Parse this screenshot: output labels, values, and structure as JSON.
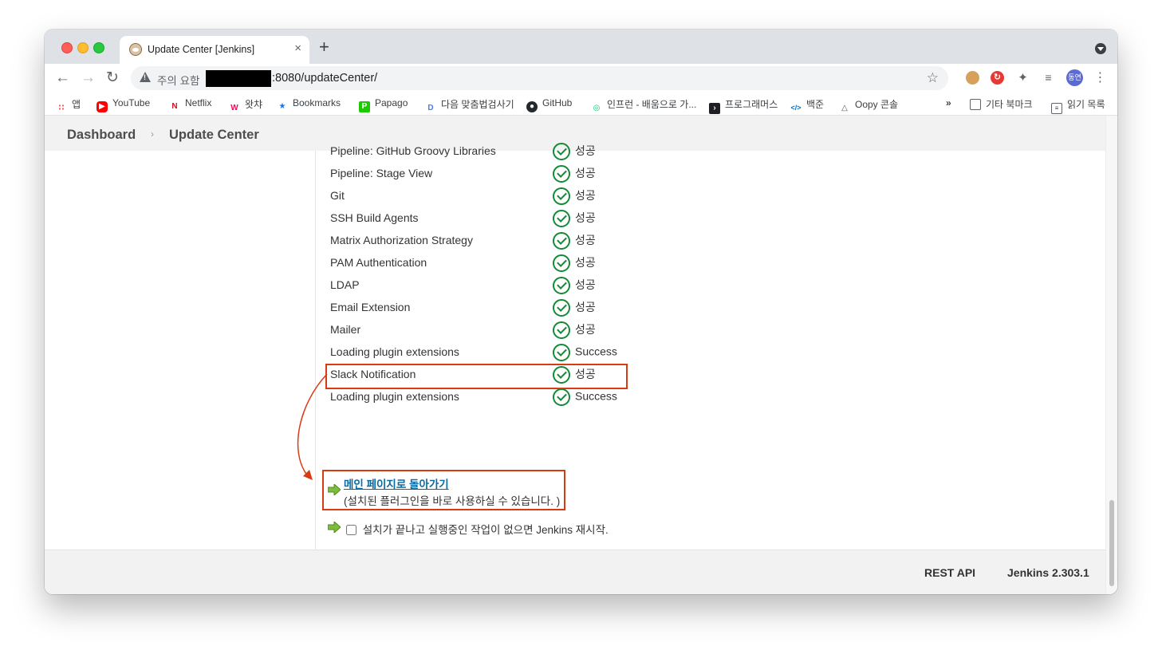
{
  "browser": {
    "tab_title": "Update Center [Jenkins]",
    "tab_close": "×",
    "new_tab": "+",
    "security_warning": "주의 요함",
    "url": ":8080/updateCenter/",
    "profile_initials": "동연",
    "bookmarks": [
      {
        "label": "앱",
        "icon": "apps-grid-icon"
      },
      {
        "label": "YouTube",
        "icon": "youtube-icon"
      },
      {
        "label": "Netflix",
        "icon": "netflix-icon"
      },
      {
        "label": "왓챠",
        "icon": "watcha-icon"
      },
      {
        "label": "Bookmarks",
        "icon": "star-icon"
      },
      {
        "label": "Papago",
        "icon": "papago-icon"
      },
      {
        "label": "다음 맞춤법검사기",
        "icon": "daum-icon"
      },
      {
        "label": "GitHub",
        "icon": "github-icon"
      },
      {
        "label": "인프런 - 배움으로 가...",
        "icon": "inflearn-icon"
      },
      {
        "label": "프로그래머스",
        "icon": "programmers-icon"
      },
      {
        "label": "백준",
        "icon": "baekjoon-icon"
      },
      {
        "label": "Oopy 콘솔",
        "icon": "oopy-icon"
      },
      {
        "label": "»",
        "icon": ""
      },
      {
        "label": "기타 북마크",
        "icon": "folder-icon"
      },
      {
        "label": "읽기 목록",
        "icon": "reading-list-icon"
      }
    ]
  },
  "breadcrumb": {
    "dashboard": "Dashboard",
    "separator": "›",
    "current": "Update Center"
  },
  "plugins": [
    {
      "name": "Pipeline: GitHub Groovy Libraries",
      "status": "성공"
    },
    {
      "name": "Pipeline: Stage View",
      "status": "성공"
    },
    {
      "name": "Git",
      "status": "성공"
    },
    {
      "name": "SSH Build Agents",
      "status": "성공"
    },
    {
      "name": "Matrix Authorization Strategy",
      "status": "성공"
    },
    {
      "name": "PAM Authentication",
      "status": "성공"
    },
    {
      "name": "LDAP",
      "status": "성공"
    },
    {
      "name": "Email Extension",
      "status": "성공"
    },
    {
      "name": "Mailer",
      "status": "성공"
    },
    {
      "name": "Loading plugin extensions",
      "status": "Success"
    },
    {
      "name": "Slack Notification",
      "status": "성공"
    },
    {
      "name": "Loading plugin extensions",
      "status": "Success"
    }
  ],
  "actions": {
    "main_page_link": "메인 페이지로 돌아가기",
    "main_page_sub": "(설치된 플러그인을 바로 사용하실 수 있습니다. )",
    "restart_label": "설치가 끝나고 실행중인 작업이 없으면 Jenkins 재시작.",
    "restart_checked": false
  },
  "footer": {
    "rest_api": "REST API",
    "version": "Jenkins 2.303.1"
  },
  "colors": {
    "success": "#138a36",
    "highlight": "#d83b12",
    "link": "#0b6aa2"
  }
}
